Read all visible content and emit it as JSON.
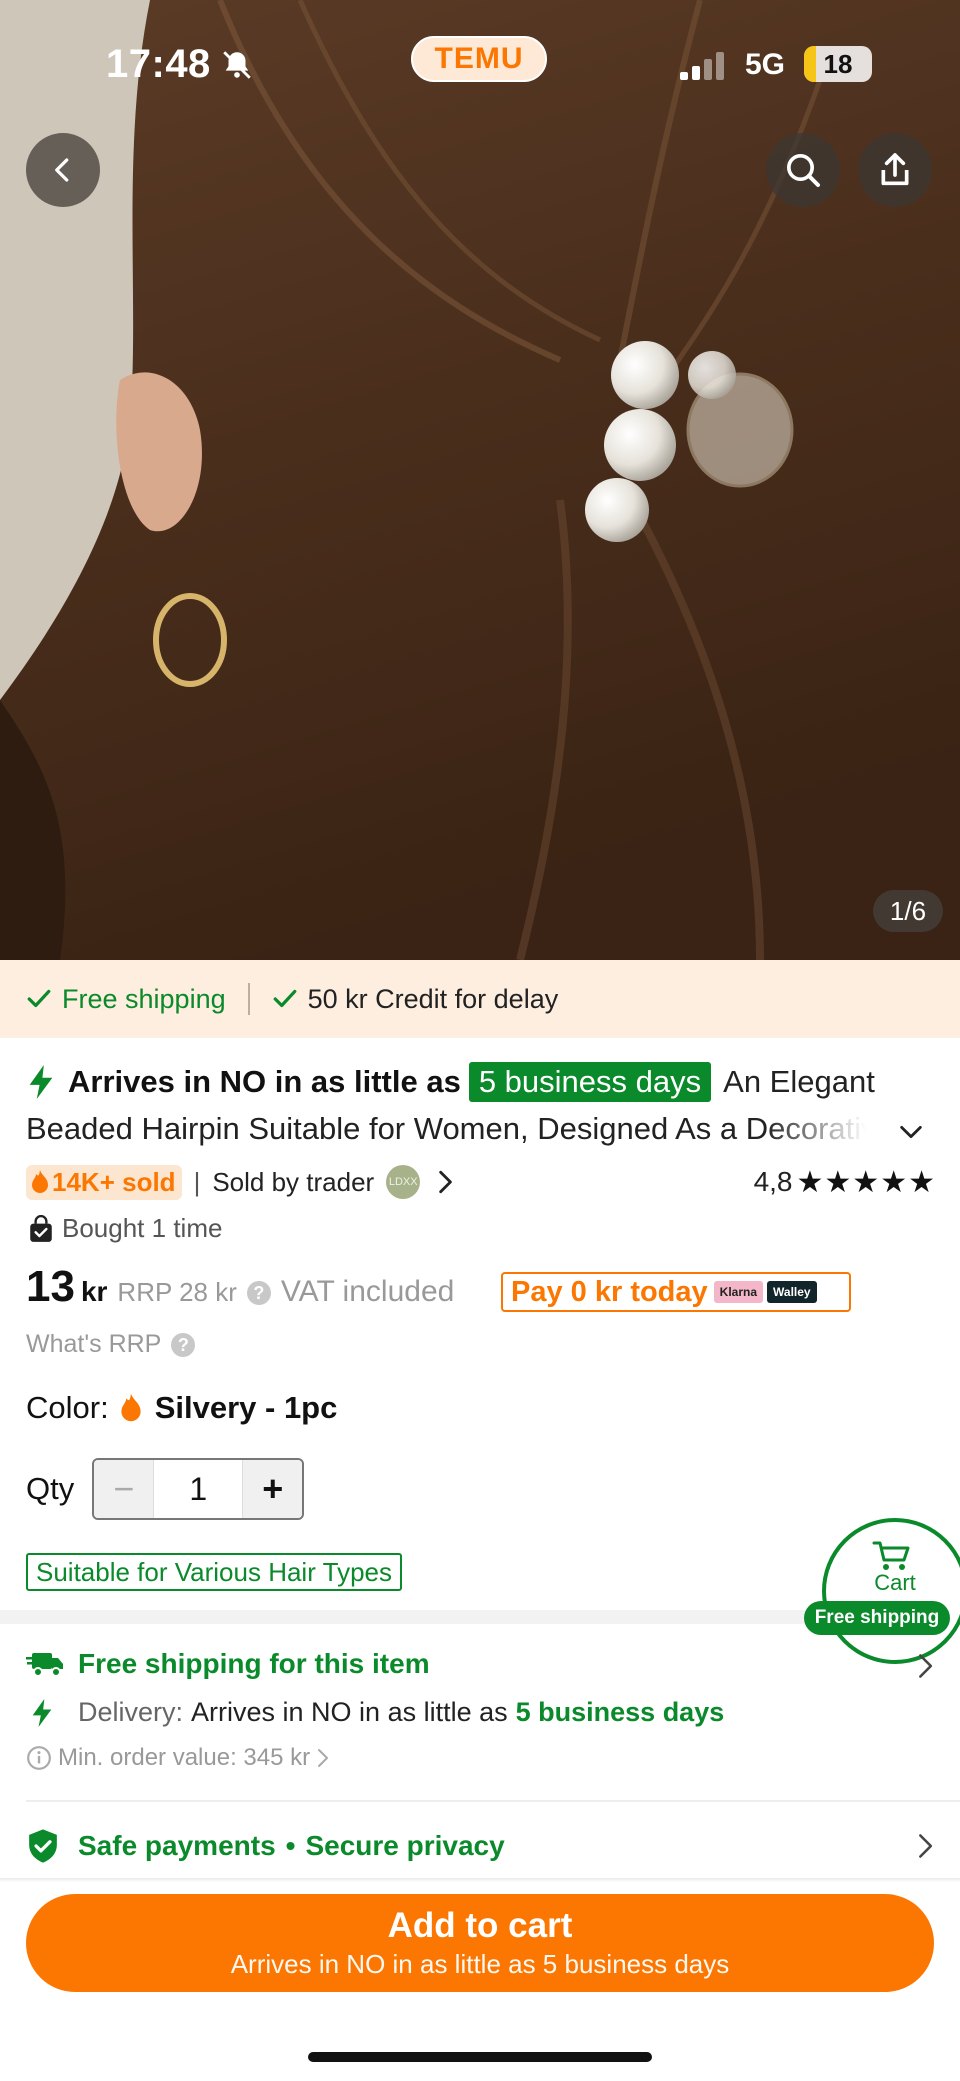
{
  "status_bar": {
    "time": "17:48",
    "app_badge": "TEMU",
    "network": "5G",
    "battery": "18",
    "battery_level": 0.18
  },
  "gallery": {
    "counter": "1/6"
  },
  "promo": {
    "free_shipping": "Free shipping",
    "credit": "50 kr Credit for delay"
  },
  "product": {
    "arrives_prefix": "Arrives in NO in as little as",
    "arrives_days": "5 business days",
    "title_start": "An Elegant",
    "title_rest": "Beaded Hairpin Suitable for Women, Designed As a Decorative Pearl Hair Clip",
    "sold": "14K+ sold",
    "seller_sep": "|",
    "seller": "Sold by trader",
    "seller_avatar": "LDXX",
    "rating": "4,8",
    "stars": "★★★★★",
    "bought": "Bought 1 time"
  },
  "price": {
    "amount": "13",
    "unit": "kr",
    "rrp": "RRP 28 kr",
    "help": "?",
    "vat": "VAT included",
    "pay_today": "Pay 0 kr today",
    "klarna": "Klarna",
    "walley": "Walley",
    "whats_rrp": "What's RRP"
  },
  "options": {
    "color_label": "Color:",
    "color_value": "Silvery - 1pc",
    "qty_label": "Qty",
    "qty_value": "1",
    "minus": "−",
    "plus": "+",
    "hair_tag": "Suitable for Various Hair Types"
  },
  "cart_float": {
    "label": "Cart",
    "badge": "Free shipping"
  },
  "shipping": {
    "title": "Free shipping for this item",
    "delivery_label": "Delivery:",
    "delivery_text": "Arrives in NO in as little as",
    "delivery_days": "5 business days",
    "min_order": "Min. order value: 345 kr"
  },
  "safety": {
    "payments": "Safe payments",
    "dot": "•",
    "privacy": "Secure privacy"
  },
  "cta": {
    "main": "Add to cart",
    "sub": "Arrives in NO in as little as 5 business days"
  },
  "colors": {
    "accent_orange": "#fb7701",
    "green": "#0a8a2a",
    "promo_bg": "#fdeee0"
  }
}
